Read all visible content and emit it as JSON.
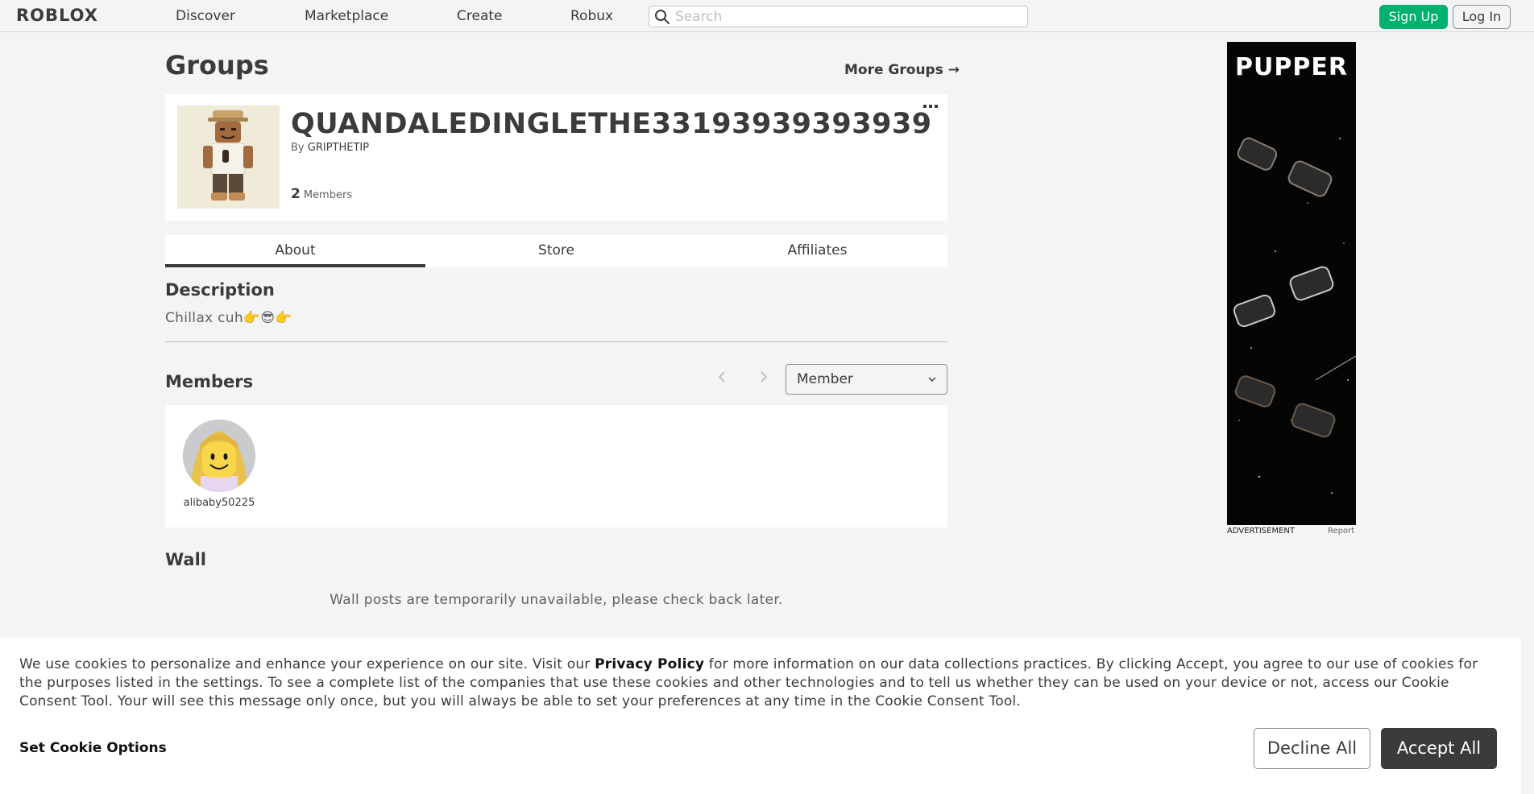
{
  "nav": {
    "logo": "ROBLOX",
    "links": [
      "Discover",
      "Marketplace",
      "Create",
      "Robux"
    ],
    "search_placeholder": "Search",
    "signup_label": "Sign Up",
    "login_label": "Log In"
  },
  "page": {
    "title": "Groups",
    "more_groups_label": "More Groups →"
  },
  "group": {
    "name": "QUANDALEDINGLETHE33193939393939",
    "by_label": "By ",
    "owner": "GRIPTHETIP",
    "member_count": "2",
    "member_count_label": "Members"
  },
  "tabs": [
    "About",
    "Store",
    "Affiliates"
  ],
  "about": {
    "description_heading": "Description",
    "description_text": "Chillax cuh👉😎👉",
    "members_heading": "Members",
    "role_filter_value": "Member",
    "members": [
      {
        "username": "alibaby50225"
      }
    ],
    "wall_heading": "Wall",
    "wall_message": "Wall posts are temporarily unavailable, please check back later."
  },
  "ad": {
    "brand": "PUPPER",
    "label": "ADVERTISEMENT",
    "report_label": "Report"
  },
  "cookie": {
    "text_before": "We use cookies to personalize and enhance your experience on our site. Visit our ",
    "policy_link": "Privacy Policy",
    "text_after": " for more information on our data collections practices. By clicking Accept, you agree to our use of cookies for the purposes listed in the settings. To see a complete list of the companies that use these cookies and other technologies and to tell us whether they can be used on your device or not, access our Cookie Consent Tool. Your will see this message only once, but you will always be able to set your preferences at any time in the Cookie Consent Tool.",
    "options_label": "Set Cookie Options",
    "decline_label": "Decline All",
    "accept_label": "Accept All"
  },
  "colors": {
    "accent_green": "#00b06f",
    "text_primary": "#393b3d",
    "page_bg": "#f2f4f5",
    "accept_bg": "#393b3d"
  }
}
